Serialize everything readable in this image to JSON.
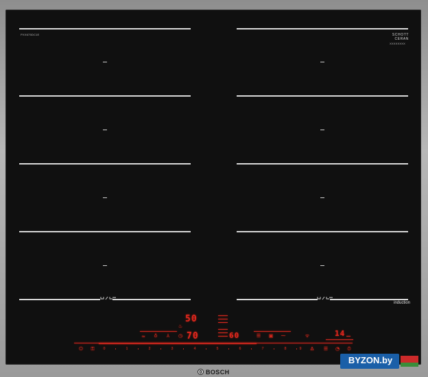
{
  "hob": {
    "model_small_print": "PXX675DC1E",
    "schott_line1": "SCHOTT",
    "schott_line2": "CERAN",
    "schott_small": "XXXXXXXX",
    "induction_label": "induction",
    "brand": "BOSCH"
  },
  "display": {
    "power_top": "50",
    "power_main": "70",
    "power_second": "60",
    "timer": "14",
    "slider_numbers": [
      "0",
      "1",
      "2",
      "3",
      "4",
      "5",
      "6",
      "7",
      "8",
      "9"
    ],
    "accent_color": "#e0271e"
  },
  "icons": {
    "power": "power-icon",
    "lock": "child-lock-icon",
    "fryer": "frying-sensor-icon",
    "move": "move-function-icon",
    "hood": "hood-link-icon",
    "timer": "timer-icon",
    "flex": "flex-zone-icon",
    "wifi": "wifi-icon"
  },
  "watermark": {
    "text": "BYZON.by"
  }
}
